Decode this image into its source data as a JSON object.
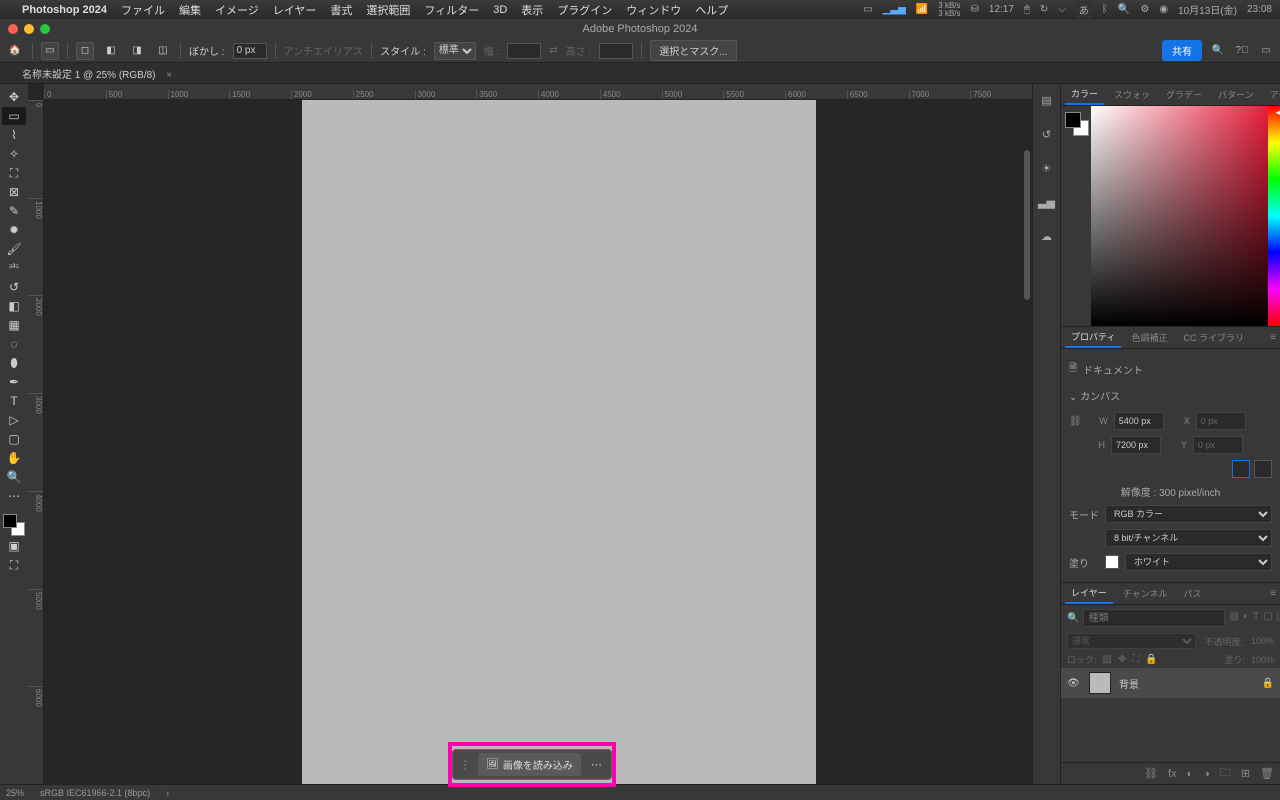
{
  "menubar": {
    "app": "Photoshop 2024",
    "items": [
      "ファイル",
      "編集",
      "イメージ",
      "レイヤー",
      "書式",
      "選択範囲",
      "フィルター",
      "3D",
      "表示",
      "プラグイン",
      "ウィンドウ",
      "ヘルプ"
    ],
    "status": {
      "net_up": "3 kB/s",
      "net_dn": "3 kB/s",
      "time": "12:17",
      "ime": "あ",
      "date": "10月13日(金)",
      "clock": "23:08"
    }
  },
  "titlebar": {
    "title": "Adobe Photoshop 2024"
  },
  "optbar": {
    "feather_label": "ぼかし :",
    "feather_value": "0 px",
    "antialias": "アンチエイリアス",
    "style_label": "スタイル :",
    "style_value": "標準",
    "width_label": "幅 :",
    "height_label": "高さ :",
    "selectmask": "選択とマスク...",
    "share": "共有"
  },
  "doctab": {
    "title": "名称未設定 1 @ 25% (RGB/8)"
  },
  "ruler_h": [
    "0",
    "500",
    "1000",
    "1500",
    "2000",
    "2500",
    "3000",
    "3500",
    "4000",
    "4500",
    "5000",
    "5500",
    "6000",
    "6500",
    "7000",
    "7500"
  ],
  "ruler_v": [
    "0",
    "1000",
    "2000",
    "3000",
    "4000",
    "5000",
    "6000"
  ],
  "panels": {
    "color_tabs": [
      "カラー",
      "スウォッ",
      "グラデー",
      "パターン",
      "アクショ"
    ],
    "prop_tabs": [
      "プロパティ",
      "色調補正",
      "CC ライブラリ"
    ],
    "doc_label": "ドキュメント",
    "canvas_section": "カンバス",
    "w_label": "W",
    "w_value": "5400 px",
    "x_label": "X",
    "x_value": "0 px",
    "h_label": "H",
    "h_value": "7200 px",
    "y_label": "Y",
    "y_value": "0 px",
    "resolution": "解像度 : 300 pixel/inch",
    "mode_label": "モード",
    "mode_value": "RGB カラー",
    "depth_value": "8 bit/チャンネル",
    "fill_label": "塗り",
    "fill_value": "ホワイト",
    "layer_tabs": [
      "レイヤー",
      "チャンネル",
      "パス"
    ],
    "layer_search_ph": "種類",
    "blend_label": "通常",
    "opacity_label": "不透明度:",
    "opacity_value": "100%",
    "lock_label": "ロック:",
    "fill2_label": "塗り:",
    "fill2_value": "100%",
    "layer_name": "背景"
  },
  "status": {
    "zoom": "25%",
    "profile": "sRGB IEC61966-2.1 (8bpc)"
  },
  "ctx": {
    "load_image": "画像を読み込み"
  }
}
